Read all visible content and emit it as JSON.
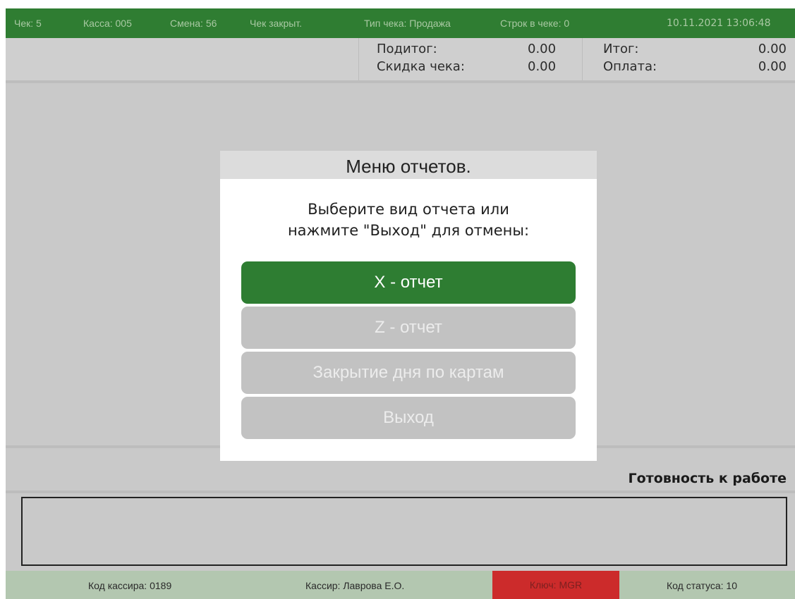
{
  "topbar": {
    "check": "Чек: 5",
    "kassa": "Касса: 005",
    "shift": "Смена: 56",
    "check_state": "Чек закрыт.",
    "check_type": "Тип чека: Продажа",
    "lines": "Строк в чеке: 0",
    "datetime": "10.11.2021 13:06:48"
  },
  "totals": {
    "subtotal_label": "Подитог:",
    "subtotal_value": "0.00",
    "discount_label": "Скидка чека:",
    "discount_value": "0.00",
    "total_label": "Итог:",
    "total_value": "0.00",
    "payment_label": "Оплата:",
    "payment_value": "0.00"
  },
  "status_text": "Готовность к работе",
  "message_box": "",
  "dialog": {
    "title": "Меню отчетов.",
    "message_line1": "Выберите вид отчета или",
    "message_line2": "нажмите \"Выход\" для отмены:",
    "buttons": [
      {
        "label": "X - отчет",
        "state": "active"
      },
      {
        "label": "Z - отчет",
        "state": "disabled"
      },
      {
        "label": "Закрытие дня по картам",
        "state": "disabled"
      },
      {
        "label": "Выход",
        "state": "disabled"
      }
    ]
  },
  "bottombar": {
    "cashier_code": "Код кассира: 0189",
    "cashier_name": "Кассир: Лаврова Е.О.",
    "key": "Ключ: MGR",
    "status_code": "Код статуса: 10"
  },
  "colors": {
    "green": "#2e7d32",
    "key_red": "#cc2b2b",
    "disabled_button": "#c2c2c2"
  }
}
